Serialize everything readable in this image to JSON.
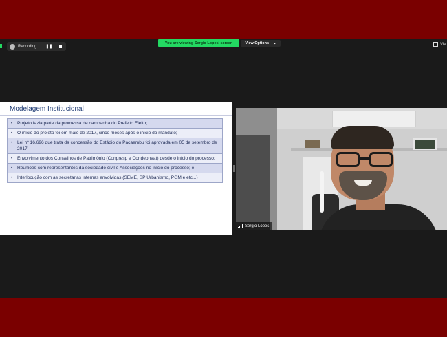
{
  "toolbar": {
    "recording_label": "Recording...",
    "pause_symbol": "❚❚",
    "viewing_banner": "You are viewing Sergio Lopes' screen",
    "view_options_label": "View Options",
    "view_options_chevron": "⌄",
    "view_right_label": "Vie"
  },
  "slide": {
    "title": "Modelagem Institucional",
    "bullets": [
      "Projeto fazia parte da promessa de campanha do Prefeito Eleito;",
      "O início do projeto foi em maio de 2017, cinco meses após o início do mandato;",
      "Lei nº 16.696 que trata da concessão do Estádio do Pacaembu foi aprovada em 05 de setembro de 2017;",
      "Envolvimento dos Conselhos de Patrimônio (Conpresp e Condephaat) desde o início do processo;",
      "Reuniões com representantes da sociedade civil e Associações  no início do processo; e",
      "Interlocução com as secretarias internas envolvidas (SEME, SP Urbanismo, PGM e etc...)"
    ],
    "bullet_symbol": "•"
  },
  "video": {
    "participant_name": "Sergio Lopes"
  },
  "colors": {
    "frame": "#7a0000",
    "meeting_bg": "#1a1a1a",
    "banner_green": "#23d962",
    "slide_title": "#1f3b73"
  }
}
